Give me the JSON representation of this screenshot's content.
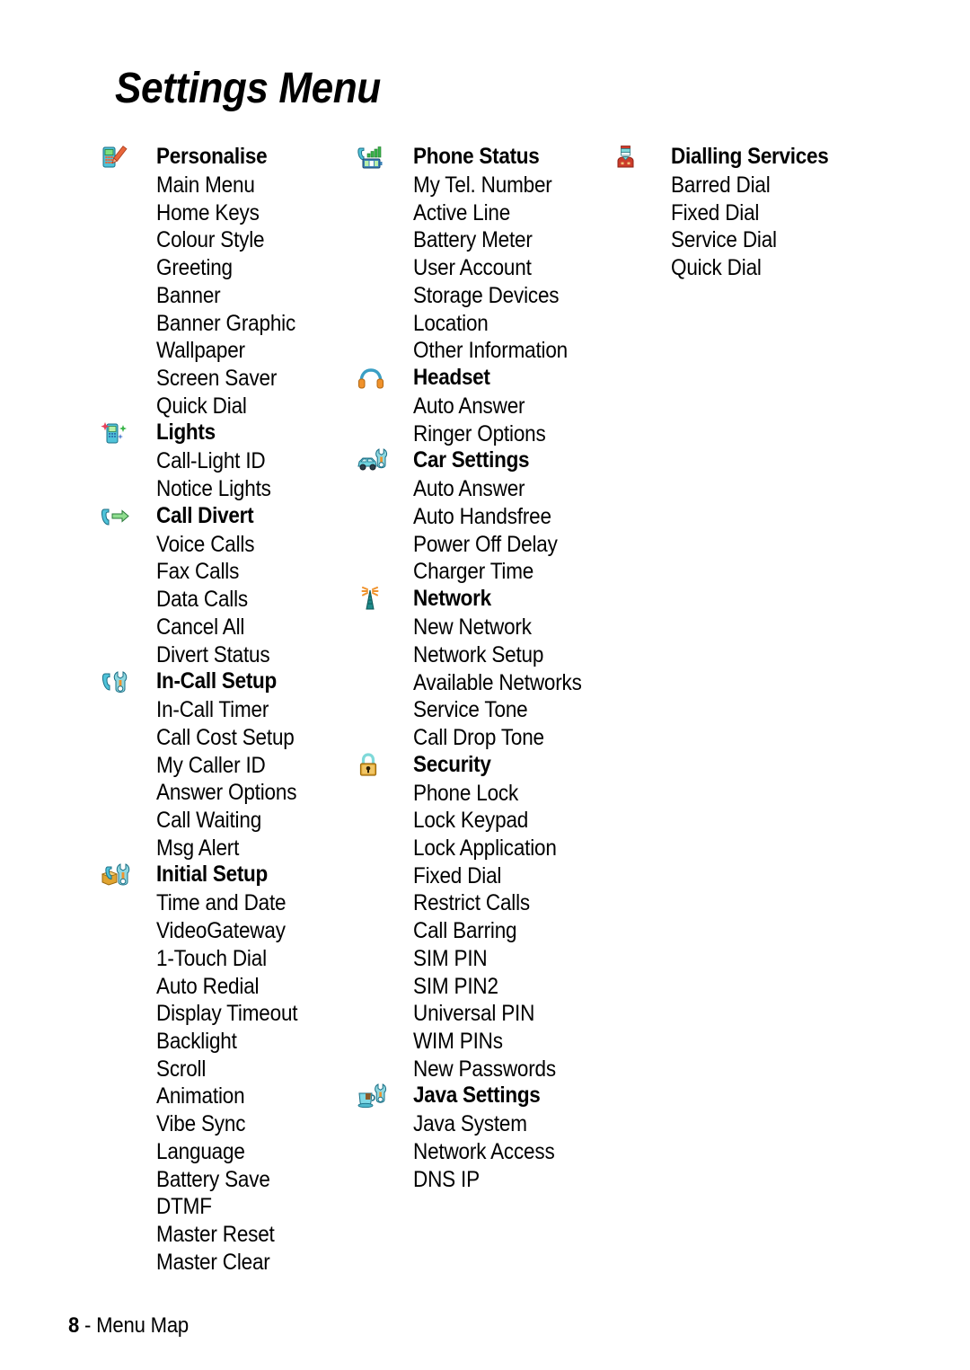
{
  "document": {
    "title": "Settings Menu",
    "footer": {
      "page_number": "8",
      "separator": " - ",
      "label": "Menu Map"
    }
  },
  "columns": [
    {
      "sections": [
        {
          "icon": "phone-pencil-icon",
          "title": "Personalise",
          "items": [
            "Main Menu",
            "Home Keys",
            "Colour Style",
            "Greeting",
            "Banner",
            "Banner Graphic",
            "Wallpaper",
            "Screen Saver",
            "Quick Dial"
          ]
        },
        {
          "icon": "phone-sparkle-icon",
          "title": "Lights",
          "items": [
            "Call-Light ID",
            "Notice Lights"
          ]
        },
        {
          "icon": "handset-arrow-icon",
          "title": "Call Divert",
          "items": [
            "Voice Calls",
            "Fax Calls",
            "Data Calls",
            "Cancel All",
            "Divert Status"
          ]
        },
        {
          "icon": "handset-wrench-icon",
          "title": "In-Call Setup",
          "items": [
            "In-Call Timer",
            "Call Cost Setup",
            "My Caller ID",
            "Answer Options",
            "Call Waiting",
            "Msg Alert"
          ]
        },
        {
          "icon": "box-handset-wrench-icon",
          "title": "Initial Setup",
          "items": [
            "Time and Date",
            "VideoGateway",
            "1-Touch Dial",
            "Auto Redial",
            "Display Timeout",
            "Backlight",
            "Scroll",
            "Animation",
            "Vibe Sync",
            "Language",
            "Battery Save",
            "DTMF",
            "Master Reset",
            "Master Clear"
          ]
        }
      ]
    },
    {
      "sections": [
        {
          "icon": "handset-signal-battery-icon",
          "title": "Phone Status",
          "items": [
            "My Tel. Number",
            "Active Line",
            "Battery Meter",
            "User Account",
            "Storage Devices",
            "Location",
            "Other Information"
          ]
        },
        {
          "icon": "headphones-icon",
          "title": "Headset",
          "items": [
            "Auto Answer",
            "Ringer Options"
          ]
        },
        {
          "icon": "car-wrench-icon",
          "title": "Car Settings",
          "items": [
            "Auto Answer",
            "Auto Handsfree",
            "Power Off Delay",
            "Charger Time"
          ]
        },
        {
          "icon": "antenna-tower-icon",
          "title": "Network",
          "items": [
            "New Network",
            "Network Setup",
            "Available Networks",
            "Service Tone",
            "Call Drop Tone"
          ]
        },
        {
          "icon": "padlock-icon",
          "title": "Security",
          "items": [
            "Phone Lock",
            "Lock Keypad",
            "Lock Application",
            "Fixed Dial",
            "Restrict Calls",
            "Call Barring",
            "SIM PIN",
            "SIM PIN2",
            "Universal PIN",
            "WIM PINs",
            "New Passwords"
          ]
        },
        {
          "icon": "coffee-cup-wrench-icon",
          "title": "Java Settings",
          "items": [
            "Java System",
            "Network Access",
            "DNS IP"
          ]
        }
      ]
    },
    {
      "sections": [
        {
          "icon": "operator-person-icon",
          "title": "Dialling Services",
          "items": [
            "Barred Dial",
            "Fixed Dial",
            "Service Dial",
            "Quick Dial"
          ]
        }
      ]
    }
  ],
  "colors": {
    "text": "#000000",
    "background": "#ffffff",
    "icon_phone_body": "#4fc3d9",
    "icon_phone_screen": "#7ee07e",
    "icon_pencil": "#e8663a",
    "icon_green": "#3ab54a",
    "icon_gold": "#e0a430",
    "icon_teal": "#7fd9d9",
    "icon_orange": "#f0922b",
    "icon_red": "#cc3b2a"
  }
}
